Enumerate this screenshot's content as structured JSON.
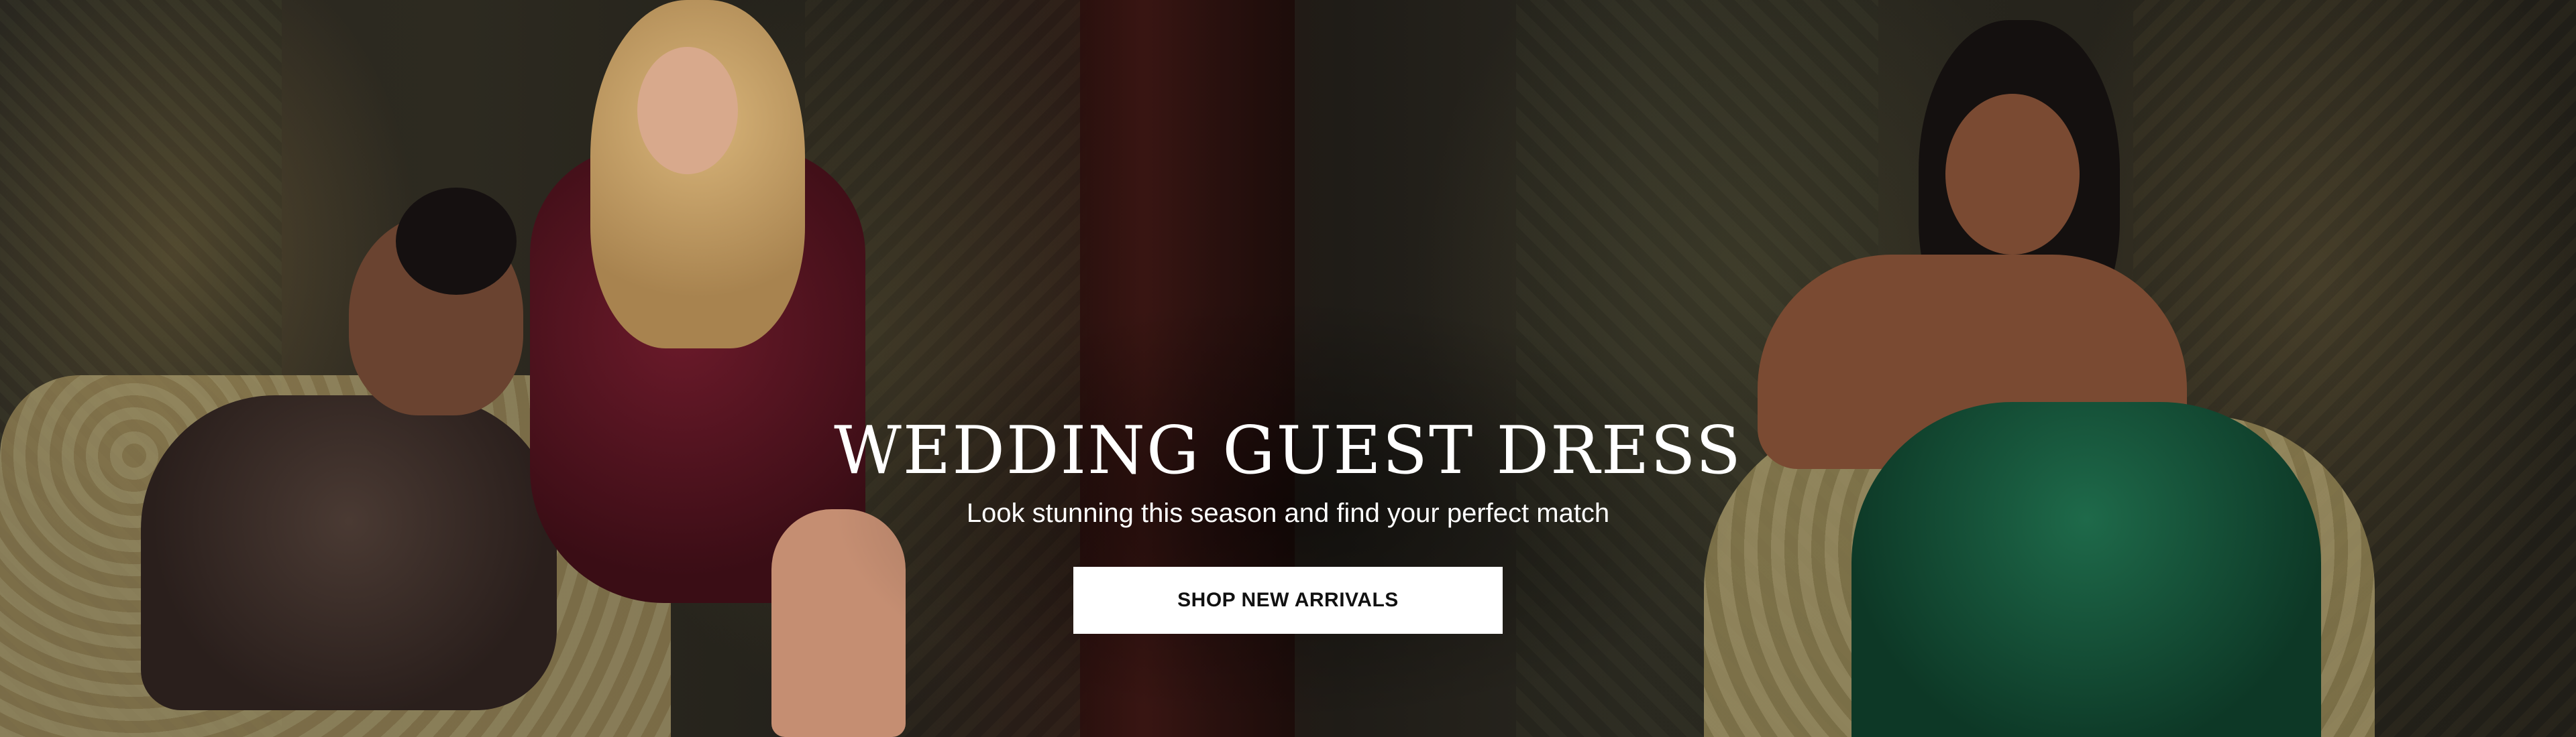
{
  "hero": {
    "title": "WEDDING GUEST DRESS",
    "subtitle": "Look stunning this season and find your perfect match",
    "cta_label": "SHOP NEW ARRIVALS"
  },
  "colors": {
    "title_text": "#ffffff",
    "cta_background": "#ffffff",
    "cta_text": "#111111"
  }
}
